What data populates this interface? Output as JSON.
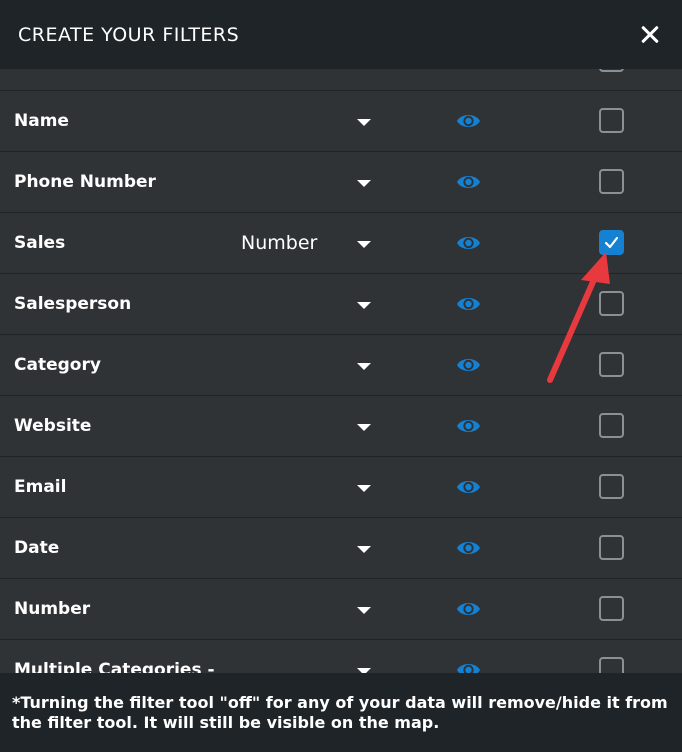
{
  "header": {
    "title": "CREATE YOUR FILTERS",
    "close_icon": "close-icon"
  },
  "rows": [
    {
      "label": "",
      "type": "",
      "checked": false
    },
    {
      "label": "Name",
      "type": "",
      "checked": false
    },
    {
      "label": "Phone Number",
      "type": "",
      "checked": false
    },
    {
      "label": "Sales",
      "type": "Number",
      "checked": true
    },
    {
      "label": "Salesperson",
      "type": "",
      "checked": false
    },
    {
      "label": "Category",
      "type": "",
      "checked": false
    },
    {
      "label": "Website",
      "type": "",
      "checked": false
    },
    {
      "label": "Email",
      "type": "",
      "checked": false
    },
    {
      "label": "Date",
      "type": "",
      "checked": false
    },
    {
      "label": "Number",
      "type": "",
      "checked": false
    },
    {
      "label": "Multiple Categories -",
      "type": "",
      "checked": false
    }
  ],
  "footer": {
    "note": "*Turning the filter tool \"off\" for any of your data will remove/hide it from the filter tool. It will still be visible on the map."
  },
  "colors": {
    "accent": "#1581d3",
    "annotation_arrow": "#e8393f",
    "background": "#2f3336",
    "header": "#1e2428"
  },
  "icons": {
    "eye": "eye-icon",
    "caret": "caret-down-icon",
    "check": "checkmark-icon"
  }
}
